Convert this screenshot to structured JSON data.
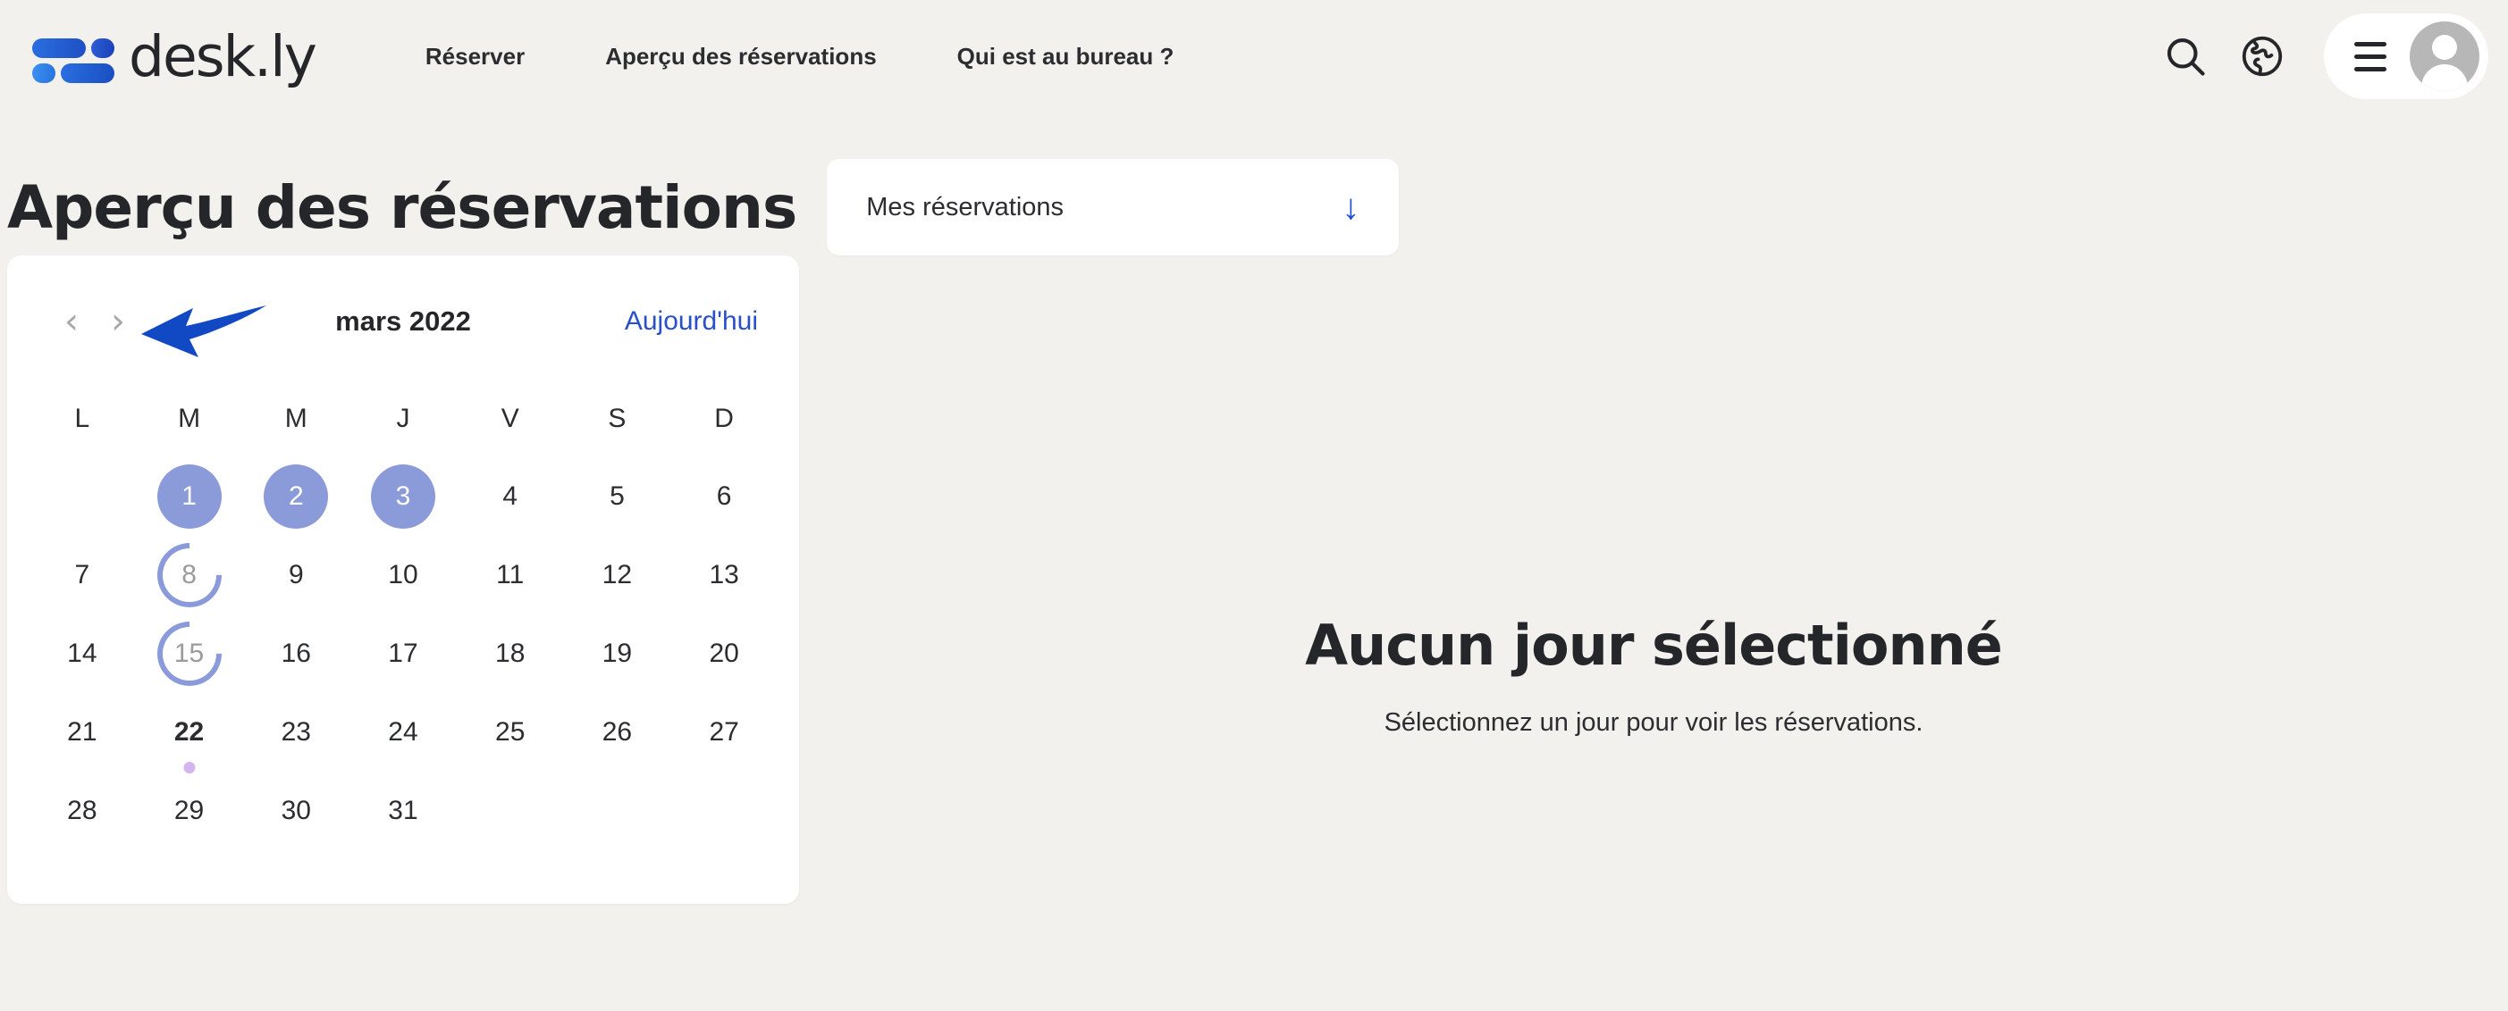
{
  "brand": {
    "name": "desk.ly",
    "logo_icon": "desk-ly-logo-icon"
  },
  "nav": {
    "links": [
      {
        "label": "Réserver"
      },
      {
        "label": "Aperçu des réservations"
      },
      {
        "label": "Qui est au bureau ?"
      }
    ],
    "search_icon": "search-icon",
    "language_icon": "globe-icon",
    "menu_icon": "hamburger-menu-icon",
    "avatar_icon": "user-avatar-icon"
  },
  "page": {
    "title": "Aperçu des réservations"
  },
  "filter_select": {
    "value": "Mes réservations",
    "arrow_glyph": "↓",
    "options": [
      "Mes réservations"
    ]
  },
  "calendar": {
    "prev_glyph": "‹",
    "next_glyph": "›",
    "month_label": "mars 2022",
    "today_link": "Aujourd'hui",
    "weekdays": [
      "L",
      "M",
      "M",
      "J",
      "V",
      "S",
      "D"
    ],
    "lead_blanks": 1,
    "days": [
      {
        "n": "1",
        "state": "selected"
      },
      {
        "n": "2",
        "state": "selected"
      },
      {
        "n": "3",
        "state": "selected"
      },
      {
        "n": "4",
        "state": "normal"
      },
      {
        "n": "5",
        "state": "normal"
      },
      {
        "n": "6",
        "state": "normal"
      },
      {
        "n": "7",
        "state": "normal"
      },
      {
        "n": "8",
        "state": "arc"
      },
      {
        "n": "9",
        "state": "normal"
      },
      {
        "n": "10",
        "state": "normal"
      },
      {
        "n": "11",
        "state": "normal"
      },
      {
        "n": "12",
        "state": "normal"
      },
      {
        "n": "13",
        "state": "normal"
      },
      {
        "n": "14",
        "state": "normal"
      },
      {
        "n": "15",
        "state": "arc"
      },
      {
        "n": "16",
        "state": "normal"
      },
      {
        "n": "17",
        "state": "normal"
      },
      {
        "n": "18",
        "state": "normal"
      },
      {
        "n": "19",
        "state": "normal"
      },
      {
        "n": "20",
        "state": "normal"
      },
      {
        "n": "21",
        "state": "normal"
      },
      {
        "n": "22",
        "state": "today"
      },
      {
        "n": "23",
        "state": "normal"
      },
      {
        "n": "24",
        "state": "normal"
      },
      {
        "n": "25",
        "state": "normal"
      },
      {
        "n": "26",
        "state": "normal"
      },
      {
        "n": "27",
        "state": "normal"
      },
      {
        "n": "28",
        "state": "normal"
      },
      {
        "n": "29",
        "state": "normal"
      },
      {
        "n": "30",
        "state": "normal"
      },
      {
        "n": "31",
        "state": "normal"
      }
    ]
  },
  "detail_panel": {
    "title": "Aucun jour sélectionné",
    "subtitle": "Sélectionnez un jour pour voir les réservations."
  },
  "annotation": {
    "arrow_color": "#1148c4",
    "points_at": "calendar-next-month-button"
  },
  "colors": {
    "page_background": "#f2f1ed",
    "card_background": "#ffffff",
    "selected_day": "#8b9ad9",
    "accent_link": "#2950c8",
    "today_dot": "#d3b6ef",
    "text_primary": "#24262a",
    "muted_text": "#9b9b9b"
  }
}
